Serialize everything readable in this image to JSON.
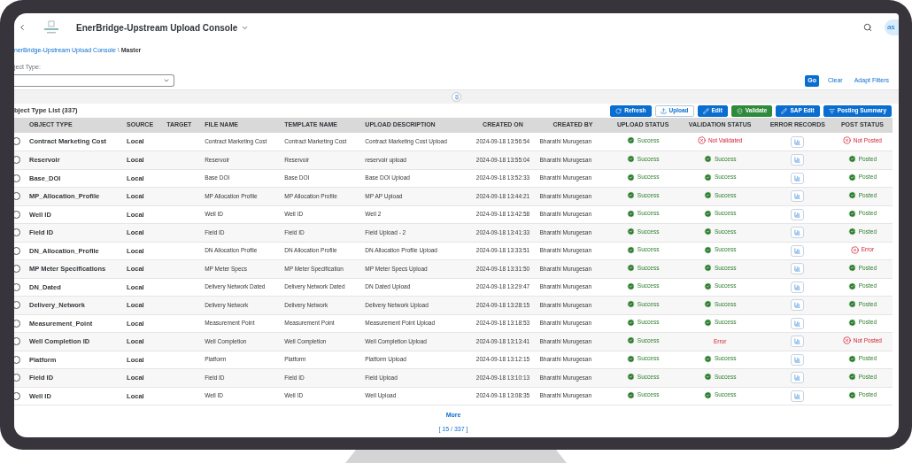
{
  "header": {
    "title": "EnerBridge-Upstream Upload Console",
    "avatar": "as"
  },
  "breadcrumb": {
    "link": "nerBridge-Upstream Upload Console",
    "separator": "\\",
    "current": "Master"
  },
  "filter": {
    "label": "ject Type:",
    "buttons": [
      {
        "label": "Go",
        "kind": "primary"
      },
      {
        "label": "Clear",
        "kind": "link"
      },
      {
        "label": "Adapt Filters",
        "kind": "link"
      }
    ]
  },
  "table": {
    "title": "bject Type List (337)",
    "toolbar": [
      {
        "label": "Refresh",
        "kind": "primary"
      },
      {
        "label": "Upload",
        "kind": "outline"
      },
      {
        "label": "Edit",
        "kind": "primary"
      },
      {
        "label": "Validate",
        "kind": "success"
      },
      {
        "label": "SAP Edit",
        "kind": "primary"
      },
      {
        "label": "Posting Summary",
        "kind": "primary"
      }
    ],
    "columns": [
      "OBJECT TYPE",
      "SOURCE",
      "TARGET",
      "FILE NAME",
      "TEMPLATE NAME",
      "UPLOAD DESCRIPTION",
      "CREATED ON",
      "CREATED BY",
      "UPLOAD STATUS",
      "VALIDATION STATUS",
      "ERROR RECORDS",
      "POST STATUS"
    ],
    "rows": [
      {
        "selected": false,
        "object_type": "Contract Marketing Cost",
        "source": "Local",
        "file_name": "Contract Marketing Cost",
        "template_name": "Contract Marketing Cost",
        "upload_description": "Contract Marketing Cost Upload",
        "created_on": "2024-09-18 13:56:54",
        "created_by": "Bharathi Murugesan",
        "upload_status": {
          "text": "Success",
          "kind": "success"
        },
        "validation_status": {
          "text": "Not Validated",
          "kind": "failed"
        },
        "post_status": {
          "text": "Not Posted",
          "kind": "failed"
        }
      },
      {
        "selected": false,
        "object_type": "Reservoir",
        "source": "Local",
        "file_name": "Reservoir",
        "template_name": "Reservoir",
        "upload_description": "reservoir upload",
        "created_on": "2024-09-18 13:55:04",
        "created_by": "Bharathi Murugesan",
        "upload_status": {
          "text": "Success",
          "kind": "success"
        },
        "validation_status": {
          "text": "Success",
          "kind": "success"
        },
        "post_status": {
          "text": "Posted",
          "kind": "success"
        }
      },
      {
        "selected": false,
        "object_type": "Base_DOI",
        "source": "Local",
        "file_name": "Base DOI",
        "template_name": "Base DOI",
        "upload_description": "Base DOI Upload",
        "created_on": "2024-09-18 13:52:33",
        "created_by": "Bharathi Murugesan",
        "upload_status": {
          "text": "Success",
          "kind": "success"
        },
        "validation_status": {
          "text": "Success",
          "kind": "success"
        },
        "post_status": {
          "text": "Posted",
          "kind": "success"
        }
      },
      {
        "selected": false,
        "object_type": "MP_Allocation_Profile",
        "source": "Local",
        "file_name": "MP Allocation Profile",
        "template_name": "MP Allocation Profile",
        "upload_description": "MP AP Upload",
        "created_on": "2024-09-18 13:44:21",
        "created_by": "Bharathi Murugesan",
        "upload_status": {
          "text": "Success",
          "kind": "success"
        },
        "validation_status": {
          "text": "Success",
          "kind": "success"
        },
        "post_status": {
          "text": "Posted",
          "kind": "success"
        }
      },
      {
        "selected": false,
        "object_type": "Well ID",
        "source": "Local",
        "file_name": "Well ID",
        "template_name": "Well ID",
        "upload_description": "Well 2",
        "created_on": "2024-09-18 13:42:58",
        "created_by": "Bharathi Murugesan",
        "upload_status": {
          "text": "Success",
          "kind": "success"
        },
        "validation_status": {
          "text": "Success",
          "kind": "success"
        },
        "post_status": {
          "text": "Posted",
          "kind": "success"
        }
      },
      {
        "selected": false,
        "object_type": "Field ID",
        "source": "Local",
        "file_name": "Field ID",
        "template_name": "Field ID",
        "upload_description": "Field Upload - 2",
        "created_on": "2024-09-18 13:41:33",
        "created_by": "Bharathi Murugesan",
        "upload_status": {
          "text": "Success",
          "kind": "success"
        },
        "validation_status": {
          "text": "Success",
          "kind": "success"
        },
        "post_status": {
          "text": "Posted",
          "kind": "success"
        }
      },
      {
        "selected": false,
        "object_type": "DN_Allocation_Profile",
        "source": "Local",
        "file_name": "DN Allocation Profile",
        "template_name": "DN Allocation Profile",
        "upload_description": "DN Allocation Profile Upload",
        "created_on": "2024-09-18 13:33:51",
        "created_by": "Bharathi Murugesan",
        "upload_status": {
          "text": "Success",
          "kind": "success"
        },
        "validation_status": {
          "text": "Success",
          "kind": "success"
        },
        "post_status": {
          "text": "Error",
          "kind": "failed"
        }
      },
      {
        "selected": false,
        "object_type": "MP Meter Specifications",
        "source": "Local",
        "file_name": "MP Meter Specs",
        "template_name": "MP Meter Specification",
        "upload_description": "MP Meter Specs Upload",
        "created_on": "2024-09-18 13:31:50",
        "created_by": "Bharathi Murugesan",
        "upload_status": {
          "text": "Success",
          "kind": "success"
        },
        "validation_status": {
          "text": "Success",
          "kind": "success"
        },
        "post_status": {
          "text": "Posted",
          "kind": "success"
        }
      },
      {
        "selected": false,
        "object_type": "DN_Dated",
        "source": "Local",
        "file_name": "Delivery Network Dated",
        "template_name": "Delivery Network Dated",
        "upload_description": "DN Dated Upload",
        "created_on": "2024-09-18 13:29:47",
        "created_by": "Bharathi Murugesan",
        "upload_status": {
          "text": "Success",
          "kind": "success"
        },
        "validation_status": {
          "text": "Success",
          "kind": "success"
        },
        "post_status": {
          "text": "Posted",
          "kind": "success"
        }
      },
      {
        "selected": false,
        "object_type": "Delivery_Network",
        "source": "Local",
        "file_name": "Delivery Network",
        "template_name": "Delivery Network",
        "upload_description": "Delivery Network Upload",
        "created_on": "2024-09-18 13:28:15",
        "created_by": "Bharathi Murugesan",
        "upload_status": {
          "text": "Success",
          "kind": "success"
        },
        "validation_status": {
          "text": "Success",
          "kind": "success"
        },
        "post_status": {
          "text": "Posted",
          "kind": "success"
        }
      },
      {
        "selected": false,
        "object_type": "Measurement_Point",
        "source": "Local",
        "file_name": "Measurement Point",
        "template_name": "Measurement Point",
        "upload_description": "Measurement Point Upload",
        "created_on": "2024-09-18 13:18:53",
        "created_by": "Bharathi Murugesan",
        "upload_status": {
          "text": "Success",
          "kind": "success"
        },
        "validation_status": {
          "text": "Success",
          "kind": "success"
        },
        "post_status": {
          "text": "Posted",
          "kind": "success"
        }
      },
      {
        "selected": false,
        "object_type": "Well Completion ID",
        "source": "Local",
        "file_name": "Well Completion",
        "template_name": "Well Completion",
        "upload_description": "Well Completion Upload",
        "created_on": "2024-09-18 13:13:41",
        "created_by": "Bharathi Murugesan",
        "upload_status": {
          "text": "Success",
          "kind": "success"
        },
        "validation_status": {
          "text": "Error",
          "kind": "error-text"
        },
        "post_status": {
          "text": "Not Posted",
          "kind": "failed"
        }
      },
      {
        "selected": false,
        "object_type": "Platform",
        "source": "Local",
        "file_name": "Platform",
        "template_name": "Platform",
        "upload_description": "Platform Upload",
        "created_on": "2024-09-18 13:12:15",
        "created_by": "Bharathi Murugesan",
        "upload_status": {
          "text": "Success",
          "kind": "success"
        },
        "validation_status": {
          "text": "Success",
          "kind": "success"
        },
        "post_status": {
          "text": "Posted",
          "kind": "success"
        }
      },
      {
        "selected": false,
        "object_type": "Field ID",
        "source": "Local",
        "file_name": "Field ID",
        "template_name": "Field ID",
        "upload_description": "Field Upload",
        "created_on": "2024-09-18 13:10:13",
        "created_by": "Bharathi Murugesan",
        "upload_status": {
          "text": "Success",
          "kind": "success"
        },
        "validation_status": {
          "text": "Success",
          "kind": "success"
        },
        "post_status": {
          "text": "Posted",
          "kind": "success"
        }
      },
      {
        "selected": false,
        "object_type": "Well ID",
        "source": "Local",
        "file_name": "Well ID",
        "template_name": "Well ID",
        "upload_description": "Well Upload",
        "created_on": "2024-09-18 13:08:35",
        "created_by": "Bharathi Murugesan",
        "upload_status": {
          "text": "Success",
          "kind": "success"
        },
        "validation_status": {
          "text": "Success",
          "kind": "success"
        },
        "post_status": {
          "text": "Posted",
          "kind": "success"
        }
      }
    ],
    "more": "More",
    "count": "[ 15 / 337 ]"
  }
}
